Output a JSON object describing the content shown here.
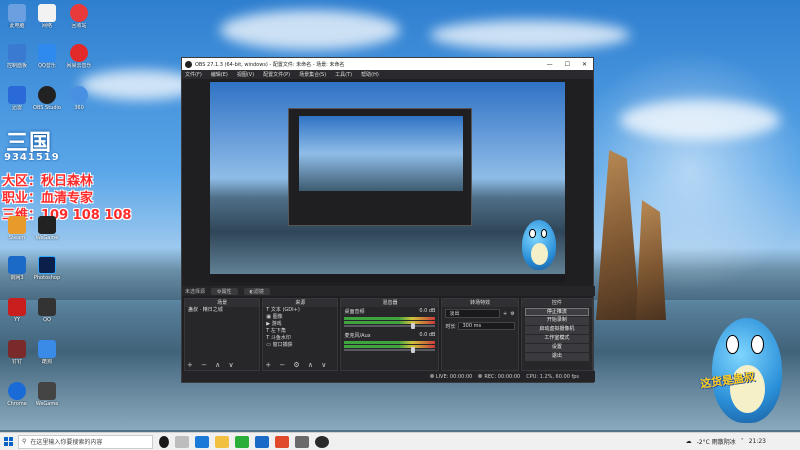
{
  "desktop": {
    "icons": [
      {
        "label": "此电脑"
      },
      {
        "label": "网络"
      },
      {
        "label": "回收站"
      },
      {
        "label": "控制面板"
      },
      {
        "label": "QQ音乐"
      },
      {
        "label": "网易云音乐"
      },
      {
        "label": "迅雷"
      },
      {
        "label": "OBS Studio"
      },
      {
        "label": "360"
      },
      {
        "label": "Steam"
      },
      {
        "label": "Photoshop"
      },
      {
        "label": "剑网3"
      },
      {
        "label": "YY"
      },
      {
        "label": "WeGame"
      },
      {
        "label": "QQ"
      },
      {
        "label": "钉钉"
      },
      {
        "label": "酷狗"
      },
      {
        "label": "Chrome"
      }
    ],
    "overlay_lines": [
      "大区：秋日森林",
      "职业：血清专家",
      "三维：109 108 108"
    ],
    "number_line": "9341519",
    "dragon_caption": "这货是蛊叔"
  },
  "obs": {
    "title": "OBS 27.1.3 (64-bit, windows) - 配置文件: 未命名 - 场景: 未命名",
    "menu": [
      "文件(F)",
      "编辑(E)",
      "视图(V)",
      "配置文件(P)",
      "场景集合(S)",
      "工具(T)",
      "帮助(H)"
    ],
    "tab_source": "未选择源",
    "tab_properties": "属性",
    "tab_filters": "滤镜",
    "docks": {
      "scenes": {
        "title": "场景",
        "items": [
          "蛊叔 · 精日之城"
        ]
      },
      "sources": {
        "title": "来源",
        "items": [
          "文本 (GDI+)",
          "图像",
          "游戏",
          "左下角",
          "斗鱼水印",
          "窗口捕获"
        ]
      },
      "mixer": {
        "title": "混音器",
        "tracks": [
          {
            "name": "桌面音频",
            "db": "0.0 dB"
          },
          {
            "name": "麦克风/Aux",
            "db": "0.0 dB"
          }
        ]
      },
      "transitions": {
        "title": "转场特效",
        "type": "淡出",
        "duration_label": "时长",
        "duration": "300 ms"
      },
      "controls": {
        "title": "控件",
        "buttons": [
          "停止推流",
          "开始录制",
          "启动虚拟摄像机",
          "工作室模式",
          "设置",
          "退出"
        ]
      }
    },
    "status": {
      "live": "LIVE: 00:00:00",
      "rec": "REC: 00:00:00",
      "cpu": "CPU: 1.2%, 60.00 fps"
    }
  },
  "taskbar": {
    "search_placeholder": "在这里输入你要搜索的内容",
    "weather": "-2°C 雨散阴冰",
    "time": "21:23"
  }
}
